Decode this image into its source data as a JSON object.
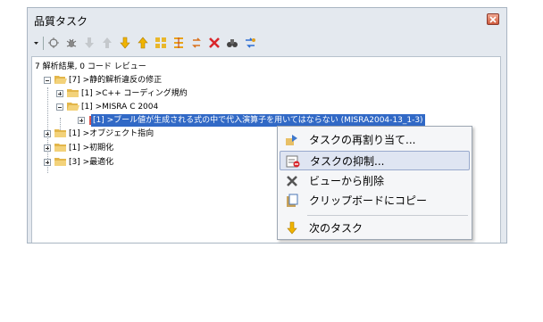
{
  "window": {
    "title": "品質タスク"
  },
  "toolbar": {
    "icons": [
      "dropdown-arrow-icon",
      "task-filter-icon",
      "bug-icon",
      "arrow-down-gray-icon",
      "arrow-up-gray-icon",
      "arrow-down-icon",
      "arrow-up-icon",
      "expand-all-icon",
      "collapse-all-icon",
      "refresh-icon",
      "delete-icon",
      "find-icon",
      "settings-icon"
    ]
  },
  "tree": {
    "summary": "7 解析結果, 0 コード レビュー",
    "root": "[7] >静的解析違反の修正",
    "items": [
      "[1] >C++ コーディング規約",
      "[1] >MISRA C 2004",
      "[1] >ブール値が生成される式の中で代入演算子を用いてはならない (MISRA2004-13_1-3)",
      "[1] >オブジェクト指向",
      "[1] >初期化",
      "[3] >最適化"
    ]
  },
  "context_menu": {
    "items": [
      {
        "label": "タスクの再割り当て...",
        "icon": "reassign-icon"
      },
      {
        "label": "タスクの抑制...",
        "icon": "suppress-icon"
      },
      {
        "label": "ビューから削除",
        "icon": "remove-x-icon"
      },
      {
        "label": "クリップボードにコピー",
        "icon": "copy-icon"
      },
      {
        "label": "次のタスク",
        "icon": "next-arrow-icon"
      }
    ]
  },
  "colors": {
    "selection": "#3169c6",
    "panel_bg": "#e4e9ef",
    "close": "#cf5a3c"
  }
}
